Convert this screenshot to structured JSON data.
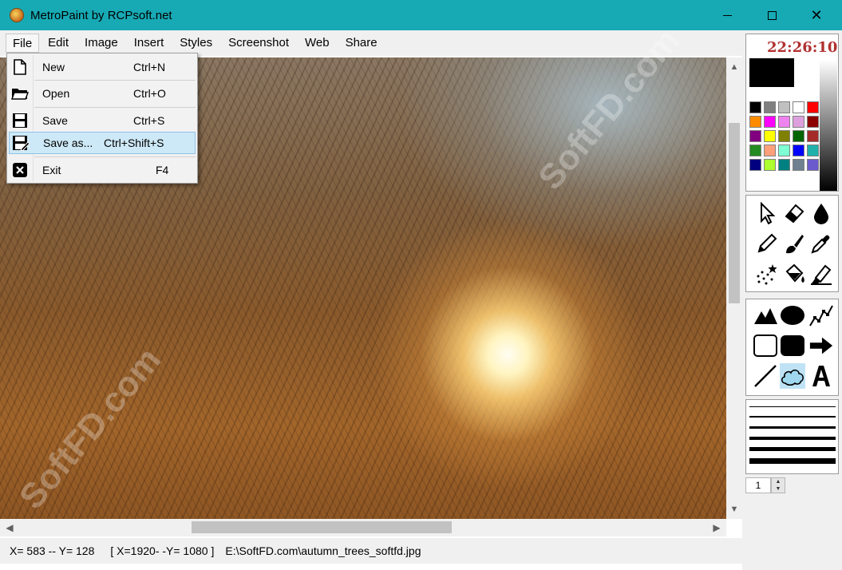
{
  "window": {
    "title": "MetroPaint by RCPsoft.net",
    "close_label": "✕"
  },
  "menubar": {
    "items": [
      "File",
      "Edit",
      "Image",
      "Insert",
      "Styles",
      "Screenshot",
      "Web",
      "Share"
    ]
  },
  "file_menu": {
    "items": [
      {
        "label": "New",
        "shortcut": "Ctrl+N",
        "icon": "new-document-icon"
      },
      {
        "label": "Open",
        "shortcut": "Ctrl+O",
        "icon": "folder-icon"
      },
      {
        "label": "Save",
        "shortcut": "Ctrl+S",
        "icon": "floppy-icon"
      },
      {
        "label": "Save as...",
        "shortcut": "Ctrl+Shift+S",
        "icon": "floppy-edit-icon"
      },
      {
        "label": "Exit",
        "shortcut": "F4",
        "icon": "exit-icon"
      }
    ],
    "highlighted": "Save as..."
  },
  "right_panel": {
    "clock": "22:26:10",
    "current_color": "#000000",
    "palette": [
      "#000000",
      "#808080",
      "#c0c0c0",
      "#ffffff",
      "#ff0000",
      "#ff8c00",
      "#ff00ff",
      "#ee82ee",
      "#dda0dd",
      "#8b0000",
      "#800080",
      "#ffff00",
      "#808000",
      "#006400",
      "#a52a2a",
      "#228b22",
      "#ffa07a",
      "#7fffd4",
      "#0000ff",
      "#20b2aa",
      "#000080",
      "#adff2f",
      "#008080",
      "#708090",
      "#6a5acd"
    ],
    "tools": [
      "arrow-icon",
      "eraser-icon",
      "drop-icon",
      "pencil-icon",
      "brush-icon",
      "color-picker-icon",
      "spray-icon",
      "fill-bucket-icon",
      "highlighter-icon"
    ],
    "shapes": [
      "triangle-icon",
      "ellipse-icon",
      "polyline-icon",
      "rectangle-icon",
      "rounded-rect-icon",
      "arrow-right-icon",
      "line-icon",
      "cloud-icon",
      "text-icon"
    ],
    "selected_shape": "cloud-icon",
    "line_width_value": "1"
  },
  "statusbar": {
    "position": "X= 583 --  Y= 128",
    "image_size": "[ X=1920- -Y= 1080 ]",
    "file_path": "E:\\SoftFD.com\\autumn_trees_softfd.jpg"
  },
  "watermark": "SoftFD.com"
}
